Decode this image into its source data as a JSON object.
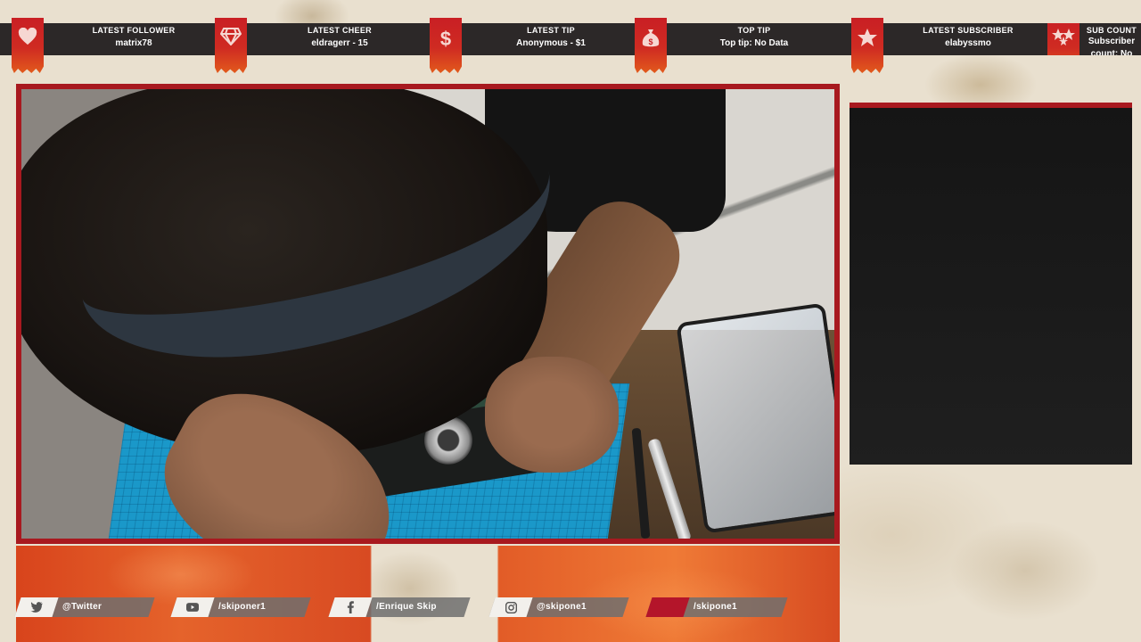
{
  "stats": [
    {
      "title": "LATEST FOLLOWER",
      "value": "matrix78",
      "icon": "heart-icon"
    },
    {
      "title": "LATEST CHEER",
      "value": "eldragerr - 15",
      "icon": "gem-icon"
    },
    {
      "title": "LATEST TIP",
      "value": "Anonymous - $1",
      "icon": "dollar-icon"
    },
    {
      "title": "TOP TIP",
      "value": "Top tip: No Data",
      "icon": "money-bag-icon"
    },
    {
      "title": "LATEST SUBSCRIBER",
      "value": "elabyssmo",
      "icon": "star-icon"
    },
    {
      "title": "SUB COUNT",
      "value": "Subscriber count: No",
      "icon": "stars-icon"
    }
  ],
  "socials": [
    {
      "label": "@Twitter",
      "icon": "twitter-icon"
    },
    {
      "label": "/skiponer1",
      "icon": "youtube-icon"
    },
    {
      "label": "/Enrique Skip",
      "icon": "facebook-icon"
    },
    {
      "label": "@skipone1",
      "icon": "instagram-icon"
    },
    {
      "label": "/skipone1",
      "icon": "twitch-icon"
    }
  ],
  "colors": {
    "accent_red": "#c91f24",
    "accent_orange": "#e25a1c",
    "bar_dark": "#2c2828",
    "parchment": "#e9e0cf"
  }
}
